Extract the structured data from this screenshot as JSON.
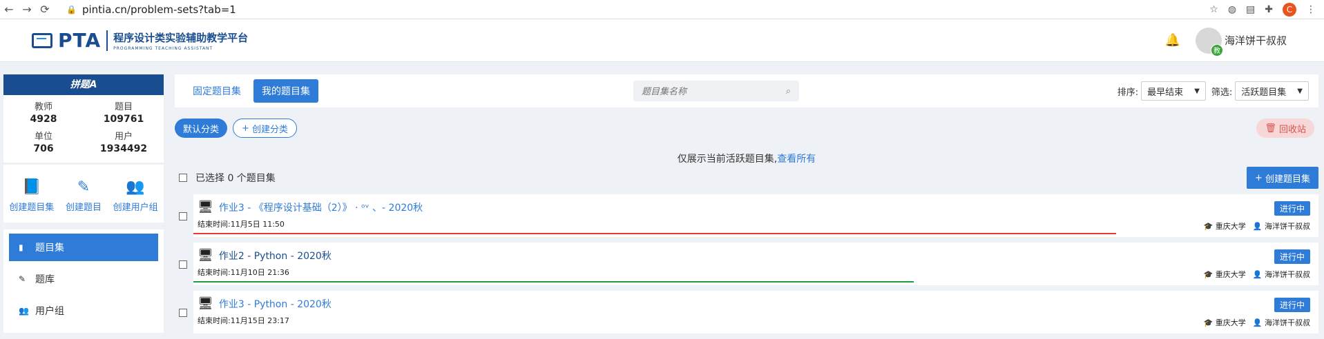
{
  "browser": {
    "url": "pintia.cn/problem-sets?tab=1",
    "profile_initial": "C"
  },
  "header": {
    "logo_text": "PTA",
    "subtitle_cn": "程序设计类实验辅助教学平台",
    "subtitle_en": "PROGRAMMING TEACHING ASSISTANT",
    "user_name": "海洋饼干叔叔",
    "role_badge": "教"
  },
  "sidebar": {
    "brand": "拼题A",
    "stats": [
      {
        "label": "教师",
        "value": "4928"
      },
      {
        "label": "题目",
        "value": "109761"
      },
      {
        "label": "单位",
        "value": "706"
      },
      {
        "label": "用户",
        "value": "1934492"
      }
    ],
    "quick": [
      {
        "label": "创建题目集",
        "icon": "book-icon"
      },
      {
        "label": "创建题目",
        "icon": "edit-icon"
      },
      {
        "label": "创建用户组",
        "icon": "users-icon"
      }
    ],
    "menu": [
      {
        "label": "题目集",
        "active": true
      },
      {
        "label": "题库",
        "active": false
      },
      {
        "label": "用户组",
        "active": false
      }
    ]
  },
  "toolbar": {
    "tabs": [
      {
        "label": "固定题目集",
        "active": false
      },
      {
        "label": "我的题目集",
        "active": true
      }
    ],
    "search_placeholder": "题目集名称",
    "sort_label": "排序:",
    "sort_value": "最早结束",
    "filter_label": "筛选:",
    "filter_value": "活跃题目集"
  },
  "categories": {
    "default_label": "默认分类",
    "create_label": "创建分类",
    "recycle_label": "回收站"
  },
  "notice": {
    "text": "仅展示当前活跃题目集,",
    "link": "查看所有"
  },
  "selection": {
    "label": "已选择 0 个题目集",
    "create_button": "创建题目集"
  },
  "problem_sets": [
    {
      "title": "作业3 - 《程序设计基础（2）》 ·  ᵒᵛ   、- 2020秋",
      "end_time": "结束时间:11月5日 11:50",
      "status": "进行中",
      "school": "重庆大学",
      "owner": "海洋饼干叔叔",
      "progress": 0.82,
      "bar_color": "#e53935",
      "title_style": "blue"
    },
    {
      "title": "作业2 - Python - 2020秋",
      "end_time": "结束时间:11月10日 21:36",
      "status": "进行中",
      "school": "重庆大学",
      "owner": "海洋饼干叔叔",
      "progress": 0.64,
      "bar_color": "#1e9e3a",
      "title_style": "dark"
    },
    {
      "title": "作业3 - Python - 2020秋",
      "end_time": "结束时间:11月15日 23:17",
      "status": "进行中",
      "school": "重庆大学",
      "owner": "海洋饼干叔叔",
      "progress": 0,
      "bar_color": "#2f7bd8",
      "title_style": "blue"
    }
  ]
}
